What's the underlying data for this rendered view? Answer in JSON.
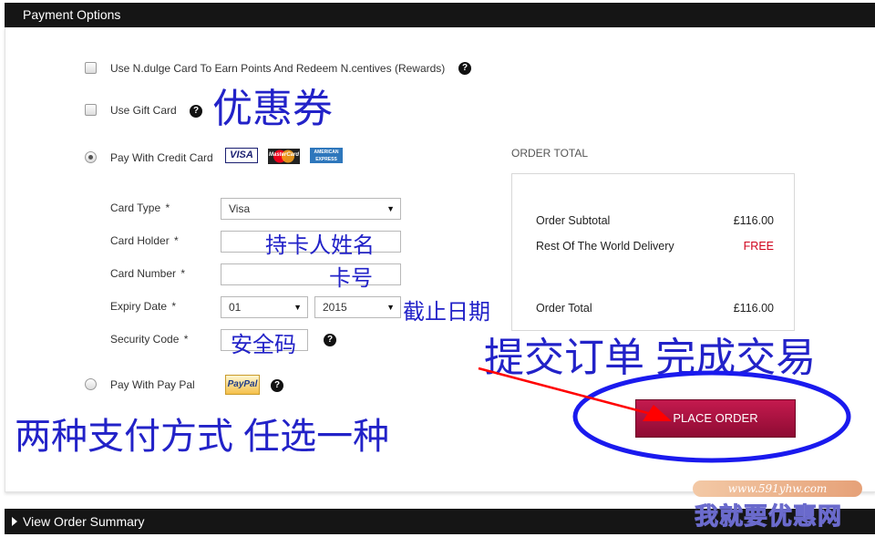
{
  "header": {
    "title": "Payment Options"
  },
  "options": {
    "rewards": {
      "label": "Use N.dulge Card To Earn Points And Redeem N.centives (Rewards)"
    },
    "gift_card": {
      "label": "Use Gift Card"
    },
    "credit_card": {
      "label": "Pay With Credit Card",
      "selected": true
    },
    "paypal": {
      "label": "Pay With Pay Pal"
    }
  },
  "card_logos": {
    "visa": "VISA",
    "mastercard": "MasterCard",
    "amex": "AMERICAN EXPRESS",
    "paypal": "PayPal"
  },
  "form": {
    "card_type": {
      "label": "Card Type",
      "value": "Visa"
    },
    "card_holder": {
      "label": "Card Holder",
      "value": ""
    },
    "card_number": {
      "label": "Card Number",
      "value": ""
    },
    "expiry_date": {
      "label": "Expiry Date",
      "month": "01",
      "year": "2015"
    },
    "security_code": {
      "label": "Security Code",
      "value": ""
    },
    "required_marker": "*"
  },
  "order_total": {
    "title": "ORDER TOTAL",
    "subtotal_label": "Order Subtotal",
    "subtotal_value": "£116.00",
    "delivery_label": "Rest Of The World Delivery",
    "delivery_value": "FREE",
    "total_label": "Order Total",
    "total_value": "£116.00"
  },
  "place_order": {
    "label": "PLACE ORDER"
  },
  "footer": {
    "label": "View Order Summary"
  },
  "annotations": {
    "coupon": "优惠券",
    "card_holder": "持卡人姓名",
    "card_number": "卡号",
    "expiry": "截止日期",
    "security_code": "安全码",
    "submit": "提交订单 完成交易",
    "payment_methods": "两种支付方式 任选一种"
  },
  "watermark": {
    "url": "www.591yhw.com",
    "text": "我就要优惠网"
  },
  "colors": {
    "annotation_blue": "#2222c8",
    "button": "#a8123f",
    "free_red": "#d0021b",
    "annotation_red": "#ff0000"
  },
  "icons": {
    "help": "?",
    "dropdown": "▼",
    "expand": "▶"
  }
}
